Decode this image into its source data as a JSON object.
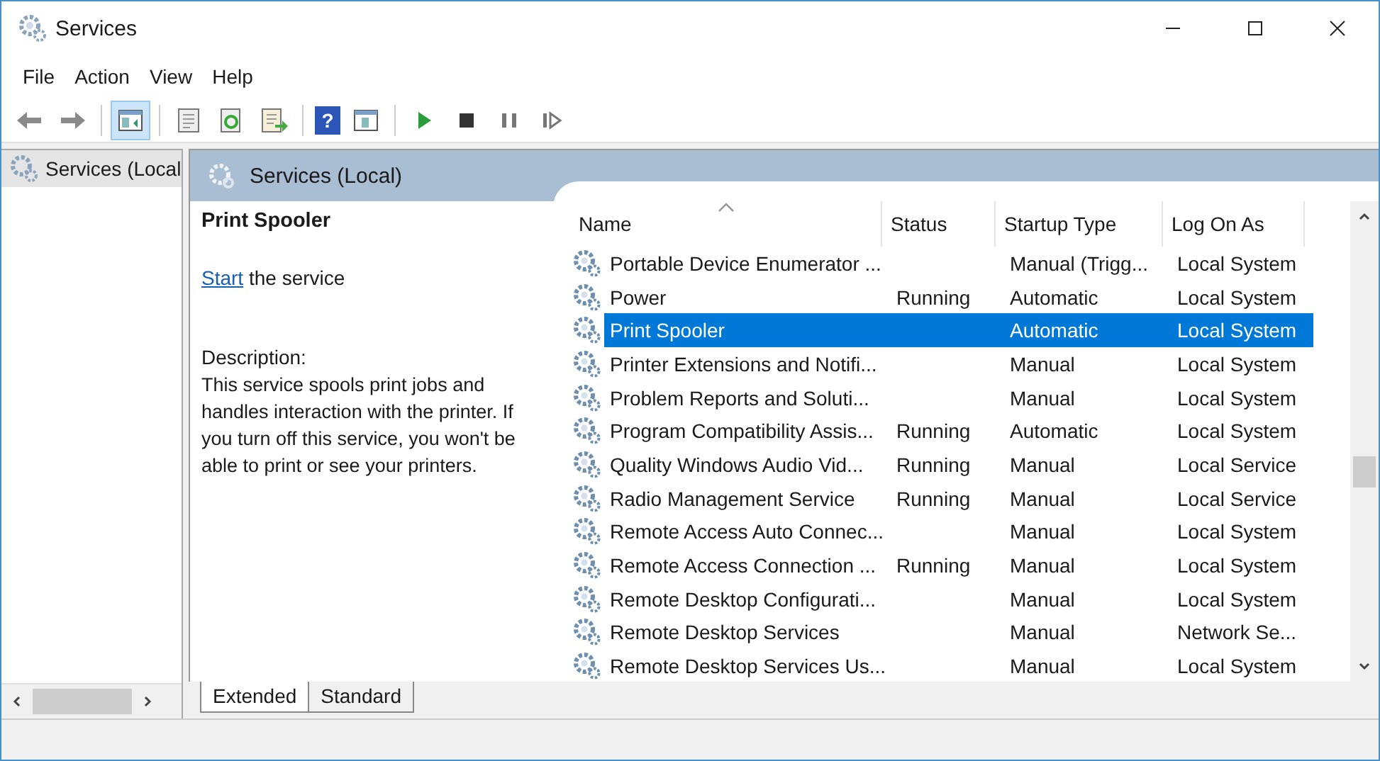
{
  "window": {
    "title": "Services"
  },
  "menu": [
    "File",
    "Action",
    "View",
    "Help"
  ],
  "toolbar": [
    {
      "kind": "back",
      "pressed": false
    },
    {
      "kind": "forward",
      "pressed": false
    },
    {
      "kind": "sep"
    },
    {
      "kind": "tree",
      "pressed": true
    },
    {
      "kind": "sep"
    },
    {
      "kind": "properties",
      "pressed": false
    },
    {
      "kind": "refresh",
      "pressed": false
    },
    {
      "kind": "export",
      "pressed": false
    },
    {
      "kind": "sep"
    },
    {
      "kind": "help",
      "pressed": false,
      "glyph": "?"
    },
    {
      "kind": "console",
      "pressed": false
    },
    {
      "kind": "sep"
    },
    {
      "kind": "play",
      "pressed": false
    },
    {
      "kind": "stop",
      "pressed": false
    },
    {
      "kind": "pause",
      "pressed": false
    },
    {
      "kind": "resume",
      "pressed": false
    }
  ],
  "tree": {
    "items": [
      {
        "label": "Services (Local",
        "selected": true
      }
    ]
  },
  "pane": {
    "title": "Services (Local)",
    "service_name": "Print Spooler",
    "action": {
      "link": "Start",
      "text": " the service"
    },
    "description_label": "Description:",
    "description": "This service spools print jobs and handles interaction with the printer. If you turn off this service, you won't be able to print or see your printers."
  },
  "table": {
    "columns": [
      {
        "label": "Name",
        "sorted": true
      },
      {
        "label": "Status",
        "sorted": false
      },
      {
        "label": "Startup Type",
        "sorted": false
      },
      {
        "label": "Log On As",
        "sorted": false
      }
    ],
    "rows": [
      {
        "name": "Portable Device Enumerator ...",
        "status": "",
        "startup": "Manual (Trigg...",
        "logon": "Local System",
        "selected": false
      },
      {
        "name": "Power",
        "status": "Running",
        "startup": "Automatic",
        "logon": "Local System",
        "selected": false
      },
      {
        "name": "Print Spooler",
        "status": "",
        "startup": "Automatic",
        "logon": "Local System",
        "selected": true
      },
      {
        "name": "Printer Extensions and Notifi...",
        "status": "",
        "startup": "Manual",
        "logon": "Local System",
        "selected": false
      },
      {
        "name": "Problem Reports and Soluti...",
        "status": "",
        "startup": "Manual",
        "logon": "Local System",
        "selected": false
      },
      {
        "name": "Program Compatibility Assis...",
        "status": "Running",
        "startup": "Automatic",
        "logon": "Local System",
        "selected": false
      },
      {
        "name": "Quality Windows Audio Vid...",
        "status": "Running",
        "startup": "Manual",
        "logon": "Local Service",
        "selected": false
      },
      {
        "name": "Radio Management Service",
        "status": "Running",
        "startup": "Manual",
        "logon": "Local Service",
        "selected": false
      },
      {
        "name": "Remote Access Auto Connec...",
        "status": "",
        "startup": "Manual",
        "logon": "Local System",
        "selected": false
      },
      {
        "name": "Remote Access Connection ...",
        "status": "Running",
        "startup": "Manual",
        "logon": "Local System",
        "selected": false
      },
      {
        "name": "Remote Desktop Configurati...",
        "status": "",
        "startup": "Manual",
        "logon": "Local System",
        "selected": false
      },
      {
        "name": "Remote Desktop Services",
        "status": "",
        "startup": "Manual",
        "logon": "Network Se...",
        "selected": false
      },
      {
        "name": "Remote Desktop Services Us...",
        "status": "",
        "startup": "Manual",
        "logon": "Local System",
        "selected": false
      }
    ]
  },
  "view_tabs": [
    {
      "label": "Extended",
      "selected": true
    },
    {
      "label": "Standard",
      "selected": false
    }
  ]
}
